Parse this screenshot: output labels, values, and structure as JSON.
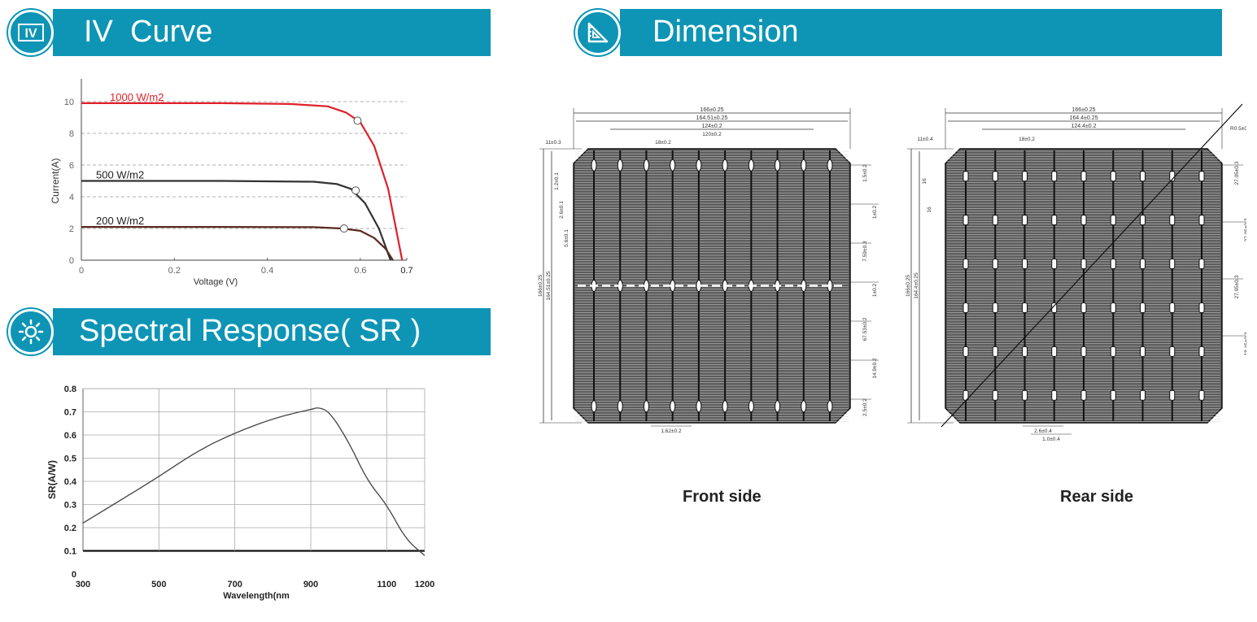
{
  "headers": {
    "iv": {
      "title": "IV  Curve",
      "icon": "iv-chart-icon"
    },
    "spectral": {
      "title": "Spectral Response( SR )",
      "icon": "sun-icon"
    },
    "dimension": {
      "title": "Dimension",
      "icon": "set-square-icon"
    }
  },
  "colors": {
    "accent": "#0e95b5",
    "curve_1000": "#e0202a",
    "curve_500": "#333333",
    "curve_200": "#5a2a20"
  },
  "chart_data": [
    {
      "type": "line",
      "xlabel": "Voltage  (V)",
      "ylabel": "Current(A)",
      "xlim": [
        0,
        0.7
      ],
      "ylim": [
        0,
        10
      ],
      "x_ticks": [
        "0",
        "0.2",
        "0.4",
        "0.6",
        "0.7"
      ],
      "y_ticks": [
        "0",
        "2",
        "4",
        "6",
        "8",
        "10"
      ],
      "series": [
        {
          "name": "1000 W/m2",
          "x": [
            0,
            0.3,
            0.45,
            0.53,
            0.57,
            0.6,
            0.63,
            0.66,
            0.68,
            0.69
          ],
          "y": [
            9.9,
            9.9,
            9.85,
            9.7,
            9.3,
            8.7,
            7.2,
            4.5,
            1.5,
            0
          ],
          "mpp": [
            0.594,
            8.8
          ]
        },
        {
          "name": "500 W/m2",
          "x": [
            0,
            0.3,
            0.5,
            0.55,
            0.58,
            0.61,
            0.64,
            0.665
          ],
          "y": [
            5.0,
            5.0,
            4.95,
            4.8,
            4.5,
            3.6,
            2.0,
            0
          ],
          "mpp": [
            0.59,
            4.4
          ]
        },
        {
          "name": "200 W/m2",
          "x": [
            0,
            0.3,
            0.5,
            0.56,
            0.6,
            0.63,
            0.655,
            0.67
          ],
          "y": [
            2.1,
            2.1,
            2.08,
            2.0,
            1.85,
            1.4,
            0.7,
            0
          ],
          "mpp": [
            0.565,
            2.0
          ]
        }
      ]
    },
    {
      "type": "line",
      "xlabel": "Wavelength(nm",
      "ylabel": "SR(A/W)",
      "xlim": [
        300,
        1200
      ],
      "ylim": [
        0,
        0.8
      ],
      "x_ticks": [
        "300",
        "500",
        "700",
        "900",
        "1100",
        "1200"
      ],
      "y_ticks": [
        "0",
        "0.1",
        "0.2",
        "0.3",
        "0.4",
        "0.5",
        "0.6",
        "0.7",
        "0.8"
      ],
      "series": [
        {
          "x": [
            300,
            400,
            500,
            600,
            700,
            800,
            870,
            900,
            920,
            950,
            1000,
            1050,
            1100,
            1150,
            1200
          ],
          "y": [
            0.22,
            0.32,
            0.42,
            0.53,
            0.61,
            0.67,
            0.7,
            0.71,
            0.72,
            0.7,
            0.57,
            0.4,
            0.3,
            0.15,
            0.08
          ]
        }
      ]
    }
  ],
  "dimension": {
    "front": {
      "label": "Front side",
      "dims_top": [
        "166±0.25",
        "164.51±0.25",
        "124±0.2",
        "120±0.2",
        "18±0.2",
        "11±0.3"
      ],
      "dims_left": [
        "166±0.25",
        "164.51±0.25",
        "1.2±0.1",
        "2.6±0.1",
        "5.6±0.1"
      ],
      "dims_right": [
        "1.5±0.2",
        "1±0.2",
        "7.59±0.3",
        "1±0.2",
        "67.53±0.2",
        "14.9±0.2",
        "2.5±0.2"
      ],
      "dims_bottom": [
        "1.62±0.2"
      ]
    },
    "rear": {
      "label": "Rear side",
      "dims_top": [
        "166±0.25",
        "164.4±0.25",
        "124.4±0.2",
        "18±0.2",
        "11±0.4",
        "R0.5±0.15"
      ],
      "dims_left": [
        "166±0.25",
        "164.4±0.25",
        "16",
        "16"
      ],
      "dims_right": [
        "27.05±0.3",
        "27.05±0.3",
        "27.05±0.3",
        "18.45±0.3"
      ],
      "dims_bottom": [
        "2.6±0.4",
        "1.0±0.4"
      ]
    }
  }
}
